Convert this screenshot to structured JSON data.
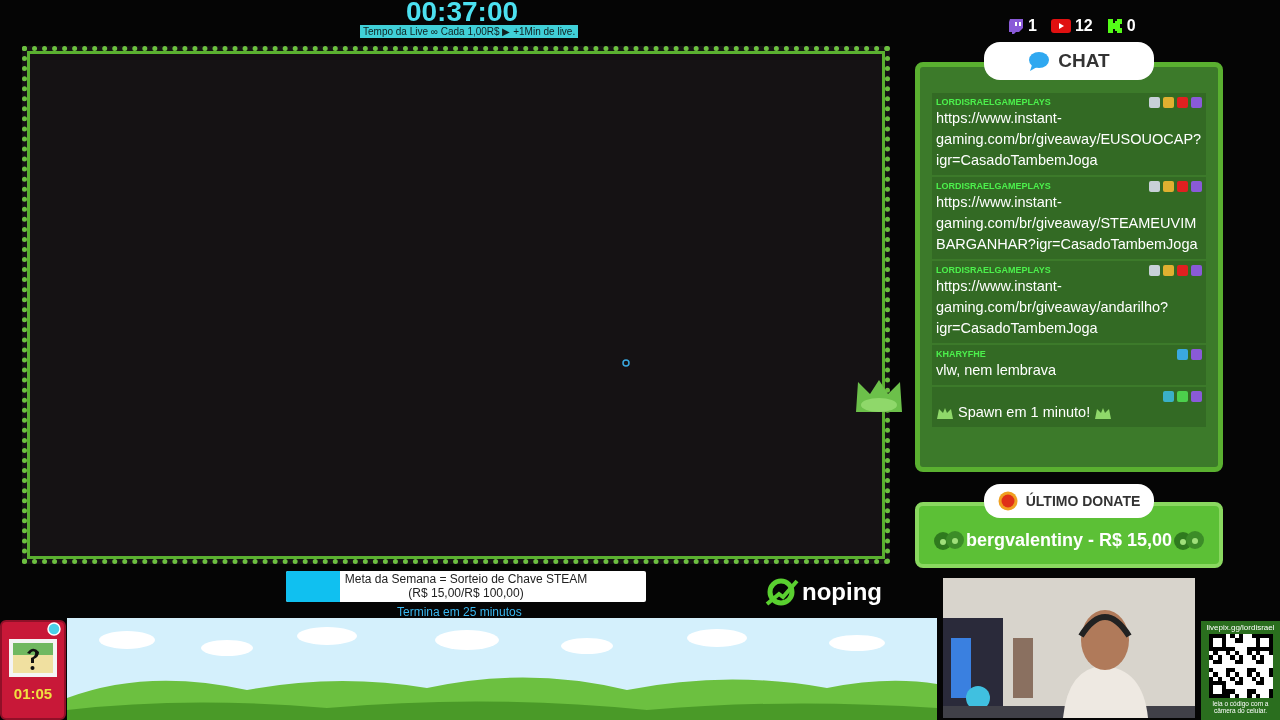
{
  "timer": {
    "time": "00:37:00",
    "caption": "Tempo da Live ∞ Cada 1,00R$ ▶ +1Min de live."
  },
  "viewer_counts": [
    {
      "kind": "twitch",
      "count": "1"
    },
    {
      "kind": "youtube",
      "count": "12"
    },
    {
      "kind": "kick",
      "count": "0"
    }
  ],
  "chat": {
    "title": "CHAT",
    "messages": [
      {
        "user": "LORDISRAELGAMEPLAYS",
        "badges": [
          {
            "kind": "clapper"
          },
          {
            "kind": "gun"
          },
          {
            "kind": "camera"
          },
          {
            "kind": "twitch"
          }
        ],
        "text": "https://www.instant-gaming.com/br/giveaway/EUSOUOCAP?igr=CasadoTambemJoga"
      },
      {
        "user": "LORDISRAELGAMEPLAYS",
        "badges": [
          {
            "kind": "clapper"
          },
          {
            "kind": "gun"
          },
          {
            "kind": "camera"
          },
          {
            "kind": "twitch"
          }
        ],
        "text": "https://www.instant-gaming.com/br/giveaway/STEAMEUVIMBARGANHAR?igr=CasadoTambemJoga"
      },
      {
        "user": "LORDISRAELGAMEPLAYS",
        "badges": [
          {
            "kind": "clapper"
          },
          {
            "kind": "gun"
          },
          {
            "kind": "camera"
          },
          {
            "kind": "twitch"
          }
        ],
        "text": "https://www.instant-gaming.com/br/giveaway/andarilho?igr=CasadoTambemJoga"
      },
      {
        "user": "KHARYFHE",
        "badges": [
          {
            "kind": "crown"
          },
          {
            "kind": "twitch"
          }
        ],
        "text": "vlw, nem lembrava"
      },
      {
        "badges": [
          {
            "kind": "robot"
          },
          {
            "kind": "sword"
          },
          {
            "kind": "twitch"
          }
        ],
        "text": "Spawn em 1 minuto!",
        "emotes": true
      }
    ]
  },
  "donate": {
    "title": "ÚLTIMO DONATE",
    "text": "bergvalentiny - R$ 15,00"
  },
  "goal": {
    "title": "Meta da Semana = Sorteio de Chave STEAM",
    "progress": "(R$ 15,00/R$ 100,00)",
    "level": 0.15,
    "ends": "Termina em 25 minutos"
  },
  "logo": {
    "text": "noping"
  },
  "pokedex": {
    "time": "01:05"
  },
  "qr": {
    "url": "livepix.gg/lordisrael",
    "hint": "leia o código com a câmera do celular."
  }
}
